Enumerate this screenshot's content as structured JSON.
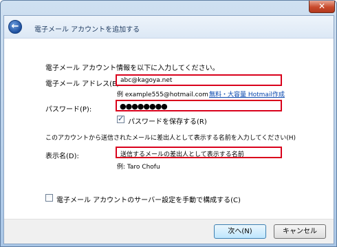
{
  "window": {
    "title": "電子メール アカウントを追加する",
    "close_glyph": "✕",
    "back_glyph": "←"
  },
  "form": {
    "intro": "電子メール アカウント情報を以下に入力してください。",
    "email_label": "電子メール アドレス(E):",
    "email_value": "abc@kagoya.net",
    "email_hint": "例 example555@hotmail.com",
    "free_link": "無料・大容量 Hotmail作成",
    "password_label": "パスワード(P):",
    "password_value": "●●●●●●●●",
    "save_password_label": "パスワードを保存する(R)",
    "save_password_checked": true,
    "display_intro": "このアカウントから送信されたメールに差出人として表示する名前を入力してください(H)",
    "display_name_label": "表示名(D):",
    "display_name_value": "送信するメールの差出人として表示する名前",
    "display_name_hint": "例: Taro Chofu",
    "manual_config_label": "電子メール アカウントのサーバー設定を手動で構成する(C)",
    "manual_config_checked": false
  },
  "footer": {
    "next_label": "次へ(N)",
    "cancel_label": "キャンセル"
  },
  "colors": {
    "highlight_border": "#d9001b",
    "link": "#0645ad"
  }
}
